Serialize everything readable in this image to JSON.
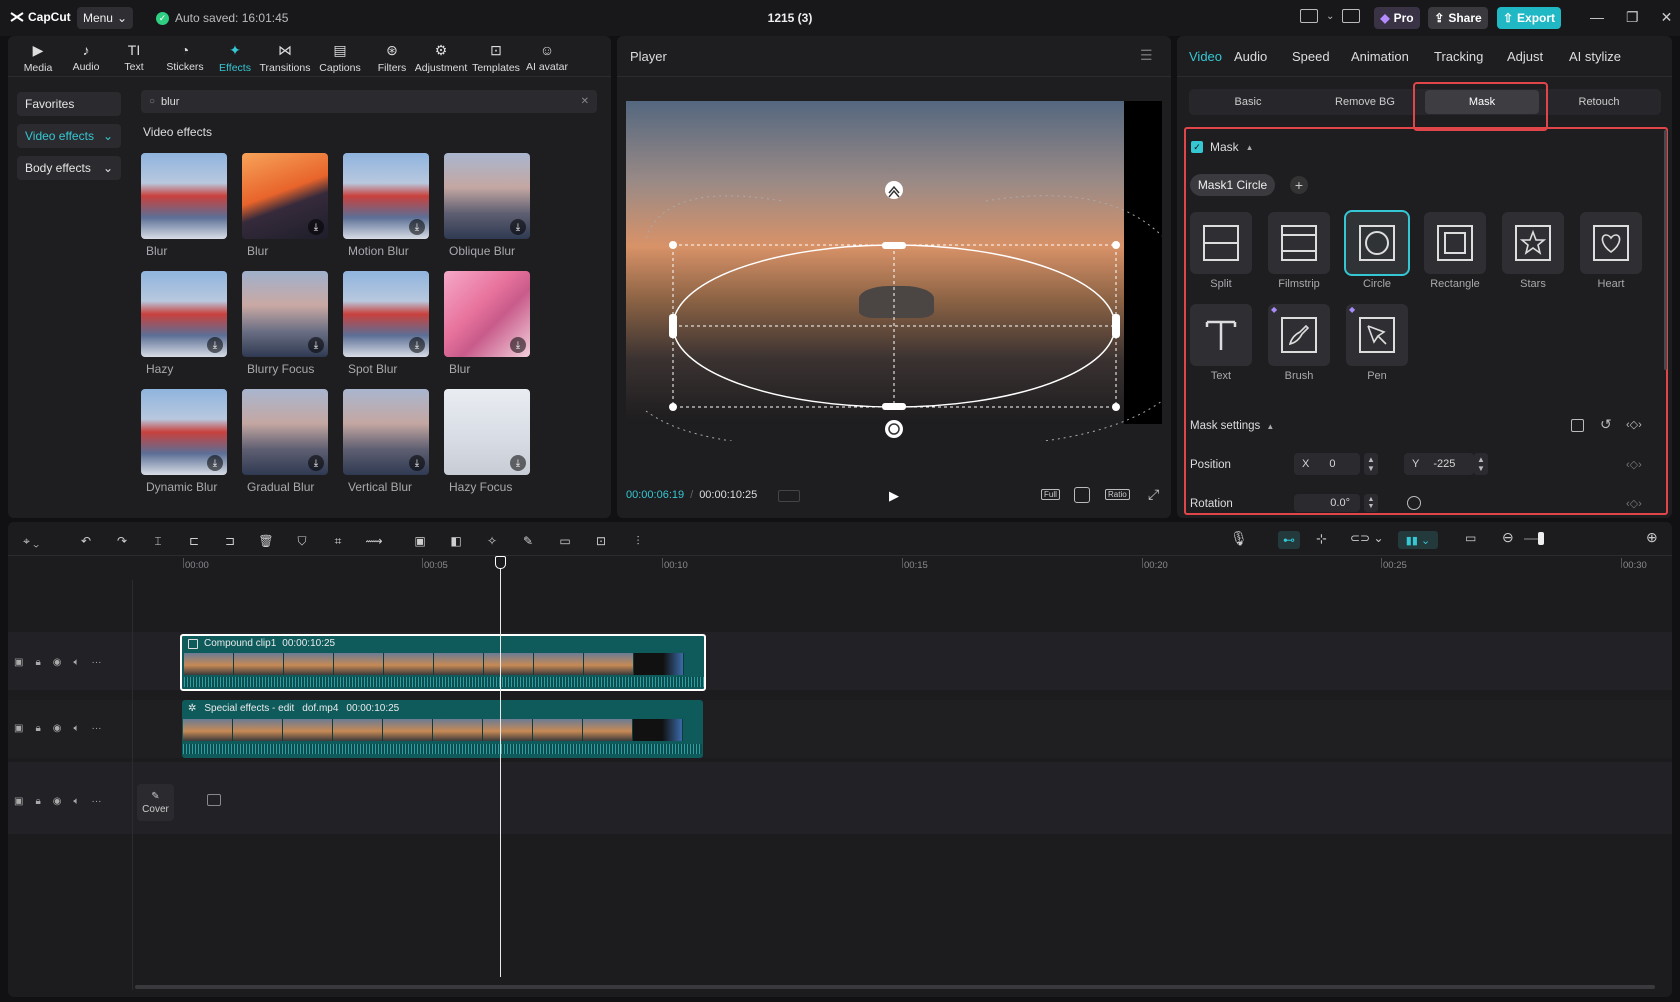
{
  "app": {
    "name": "CapCut",
    "menu_label": "Menu",
    "autosave": "Auto saved: 16:01:45",
    "project_title": "1215 (3)",
    "pro_label": "Pro",
    "share_label": "Share",
    "export_label": "Export"
  },
  "colors": {
    "accent": "#35c7d3",
    "export_bg": "#1fb8c4",
    "highlight_border": "#e0454a",
    "clip_bg": "#0f5b5c"
  },
  "toolbar": [
    {
      "label": "Media",
      "icon": "media-icon"
    },
    {
      "label": "Audio",
      "icon": "audio-icon"
    },
    {
      "label": "Text",
      "icon": "text-icon"
    },
    {
      "label": "Stickers",
      "icon": "stickers-icon"
    },
    {
      "label": "Effects",
      "icon": "effects-icon",
      "active": true
    },
    {
      "label": "Transitions",
      "icon": "transitions-icon"
    },
    {
      "label": "Captions",
      "icon": "captions-icon"
    },
    {
      "label": "Filters",
      "icon": "filters-icon"
    },
    {
      "label": "Adjustment",
      "icon": "adjustment-icon"
    },
    {
      "label": "Templates",
      "icon": "templates-icon"
    },
    {
      "label": "AI avatar",
      "icon": "ai-avatar-icon"
    }
  ],
  "sidebar": {
    "favorites": "Favorites",
    "video_effects": "Video effects",
    "body_effects": "Body effects"
  },
  "search": {
    "value": "blur"
  },
  "effects": {
    "section_title": "Video effects",
    "items": [
      {
        "label": "Blur"
      },
      {
        "label": "Blur"
      },
      {
        "label": "Motion Blur"
      },
      {
        "label": "Oblique Blur"
      },
      {
        "label": "Hazy"
      },
      {
        "label": "Blurry Focus"
      },
      {
        "label": "Spot Blur"
      },
      {
        "label": "Blur"
      },
      {
        "label": "Dynamic Blur"
      },
      {
        "label": "Gradual Blur"
      },
      {
        "label": "Vertical Blur"
      },
      {
        "label": "Hazy Focus"
      }
    ]
  },
  "player": {
    "title": "Player",
    "current_time": "00:00:06:19",
    "total_time": "00:00:10:25",
    "full_label": "Full",
    "ratio_label": "Ratio"
  },
  "right_panel": {
    "tabs": [
      "Video",
      "Audio",
      "Speed",
      "Animation",
      "Tracking",
      "Adjust",
      "AI stylize"
    ],
    "subtabs": [
      "Basic",
      "Remove BG",
      "Mask",
      "Retouch"
    ],
    "mask_label": "Mask",
    "mask_chip": "Mask1 Circle",
    "shapes": [
      "Split",
      "Filmstrip",
      "Circle",
      "Rectangle",
      "Stars",
      "Heart",
      "Text",
      "Brush",
      "Pen"
    ],
    "mask_settings_label": "Mask settings",
    "position_label": "Position",
    "x_label": "X",
    "x_value": "0",
    "y_label": "Y",
    "y_value": "-225",
    "rotation_label": "Rotation",
    "rotation_value": "0.0°"
  },
  "timeline": {
    "ruler": [
      "00:00",
      "00:05",
      "00:10",
      "00:15",
      "00:20",
      "00:25",
      "00:30"
    ],
    "clip1_name": "Compound clip1",
    "clip1_duration": "00:00:10:25",
    "clip2_name": "Special effects - edit",
    "clip2_file": "dof.mp4",
    "clip2_duration": "00:00:10:25",
    "cover_label": "Cover"
  }
}
